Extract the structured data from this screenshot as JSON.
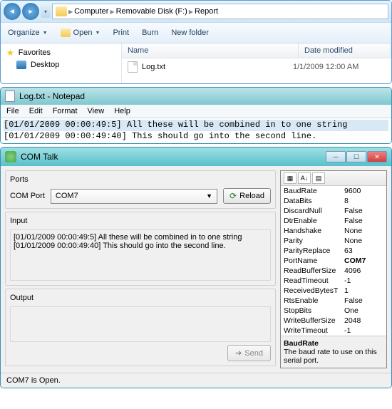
{
  "explorer": {
    "breadcrumb": [
      "Computer",
      "Removable Disk (F:)",
      "Report"
    ],
    "toolbar": {
      "organize": "Organize",
      "open": "Open",
      "print": "Print",
      "burn": "Burn",
      "newfolder": "New folder"
    },
    "sidebar": {
      "favorites": "Favorites",
      "desktop": "Desktop"
    },
    "columns": {
      "name": "Name",
      "date": "Date modified"
    },
    "files": [
      {
        "name": "Log.txt",
        "date": "1/1/2009 12:00 AM"
      }
    ]
  },
  "notepad": {
    "title": "Log.txt - Notepad",
    "menu": [
      "File",
      "Edit",
      "Format",
      "View",
      "Help"
    ],
    "lines": [
      "[01/01/2009 00:00:49:5] All these will be combined in to one string",
      "[01/01/2009 00:00:49:40] This should go into the second line."
    ]
  },
  "comtalk": {
    "title": "COM Talk",
    "ports_label": "Ports",
    "comport_label": "COM Port",
    "comport_value": "COM7",
    "reload": "Reload",
    "input_label": "Input",
    "input_lines": [
      "[01/01/2009 00:00:49:5] All these will be combined in to one string",
      "[01/01/2009 00:00:49:40] This should go into the second line."
    ],
    "output_label": "Output",
    "send": "Send",
    "props": [
      {
        "k": "BaudRate",
        "v": "9600"
      },
      {
        "k": "DataBits",
        "v": "8"
      },
      {
        "k": "DiscardNull",
        "v": "False"
      },
      {
        "k": "DtrEnable",
        "v": "False"
      },
      {
        "k": "Handshake",
        "v": "None"
      },
      {
        "k": "Parity",
        "v": "None"
      },
      {
        "k": "ParityReplace",
        "v": "63"
      },
      {
        "k": "PortName",
        "v": "COM7",
        "bold": true
      },
      {
        "k": "ReadBufferSize",
        "v": "4096"
      },
      {
        "k": "ReadTimeout",
        "v": "-1"
      },
      {
        "k": "ReceivedBytesT",
        "v": "1"
      },
      {
        "k": "RtsEnable",
        "v": "False"
      },
      {
        "k": "StopBits",
        "v": "One"
      },
      {
        "k": "WriteBufferSize",
        "v": "2048"
      },
      {
        "k": "WriteTimeout",
        "v": "-1"
      }
    ],
    "desc_title": "BaudRate",
    "desc_text": "The baud rate to use on this serial port.",
    "status": "COM7 is Open."
  }
}
